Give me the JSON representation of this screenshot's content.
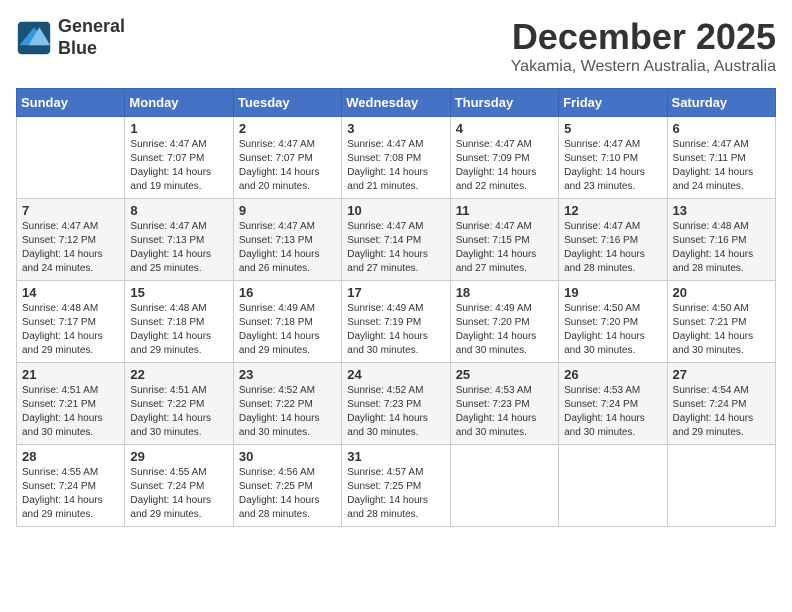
{
  "header": {
    "logo_line1": "General",
    "logo_line2": "Blue",
    "month": "December 2025",
    "location": "Yakamia, Western Australia, Australia"
  },
  "weekdays": [
    "Sunday",
    "Monday",
    "Tuesday",
    "Wednesday",
    "Thursday",
    "Friday",
    "Saturday"
  ],
  "weeks": [
    [
      {
        "day": "",
        "info": ""
      },
      {
        "day": "1",
        "info": "Sunrise: 4:47 AM\nSunset: 7:07 PM\nDaylight: 14 hours\nand 19 minutes."
      },
      {
        "day": "2",
        "info": "Sunrise: 4:47 AM\nSunset: 7:07 PM\nDaylight: 14 hours\nand 20 minutes."
      },
      {
        "day": "3",
        "info": "Sunrise: 4:47 AM\nSunset: 7:08 PM\nDaylight: 14 hours\nand 21 minutes."
      },
      {
        "day": "4",
        "info": "Sunrise: 4:47 AM\nSunset: 7:09 PM\nDaylight: 14 hours\nand 22 minutes."
      },
      {
        "day": "5",
        "info": "Sunrise: 4:47 AM\nSunset: 7:10 PM\nDaylight: 14 hours\nand 23 minutes."
      },
      {
        "day": "6",
        "info": "Sunrise: 4:47 AM\nSunset: 7:11 PM\nDaylight: 14 hours\nand 24 minutes."
      }
    ],
    [
      {
        "day": "7",
        "info": "Sunrise: 4:47 AM\nSunset: 7:12 PM\nDaylight: 14 hours\nand 24 minutes."
      },
      {
        "day": "8",
        "info": "Sunrise: 4:47 AM\nSunset: 7:13 PM\nDaylight: 14 hours\nand 25 minutes."
      },
      {
        "day": "9",
        "info": "Sunrise: 4:47 AM\nSunset: 7:13 PM\nDaylight: 14 hours\nand 26 minutes."
      },
      {
        "day": "10",
        "info": "Sunrise: 4:47 AM\nSunset: 7:14 PM\nDaylight: 14 hours\nand 27 minutes."
      },
      {
        "day": "11",
        "info": "Sunrise: 4:47 AM\nSunset: 7:15 PM\nDaylight: 14 hours\nand 27 minutes."
      },
      {
        "day": "12",
        "info": "Sunrise: 4:47 AM\nSunset: 7:16 PM\nDaylight: 14 hours\nand 28 minutes."
      },
      {
        "day": "13",
        "info": "Sunrise: 4:48 AM\nSunset: 7:16 PM\nDaylight: 14 hours\nand 28 minutes."
      }
    ],
    [
      {
        "day": "14",
        "info": "Sunrise: 4:48 AM\nSunset: 7:17 PM\nDaylight: 14 hours\nand 29 minutes."
      },
      {
        "day": "15",
        "info": "Sunrise: 4:48 AM\nSunset: 7:18 PM\nDaylight: 14 hours\nand 29 minutes."
      },
      {
        "day": "16",
        "info": "Sunrise: 4:49 AM\nSunset: 7:18 PM\nDaylight: 14 hours\nand 29 minutes."
      },
      {
        "day": "17",
        "info": "Sunrise: 4:49 AM\nSunset: 7:19 PM\nDaylight: 14 hours\nand 30 minutes."
      },
      {
        "day": "18",
        "info": "Sunrise: 4:49 AM\nSunset: 7:20 PM\nDaylight: 14 hours\nand 30 minutes."
      },
      {
        "day": "19",
        "info": "Sunrise: 4:50 AM\nSunset: 7:20 PM\nDaylight: 14 hours\nand 30 minutes."
      },
      {
        "day": "20",
        "info": "Sunrise: 4:50 AM\nSunset: 7:21 PM\nDaylight: 14 hours\nand 30 minutes."
      }
    ],
    [
      {
        "day": "21",
        "info": "Sunrise: 4:51 AM\nSunset: 7:21 PM\nDaylight: 14 hours\nand 30 minutes."
      },
      {
        "day": "22",
        "info": "Sunrise: 4:51 AM\nSunset: 7:22 PM\nDaylight: 14 hours\nand 30 minutes."
      },
      {
        "day": "23",
        "info": "Sunrise: 4:52 AM\nSunset: 7:22 PM\nDaylight: 14 hours\nand 30 minutes."
      },
      {
        "day": "24",
        "info": "Sunrise: 4:52 AM\nSunset: 7:23 PM\nDaylight: 14 hours\nand 30 minutes."
      },
      {
        "day": "25",
        "info": "Sunrise: 4:53 AM\nSunset: 7:23 PM\nDaylight: 14 hours\nand 30 minutes."
      },
      {
        "day": "26",
        "info": "Sunrise: 4:53 AM\nSunset: 7:24 PM\nDaylight: 14 hours\nand 30 minutes."
      },
      {
        "day": "27",
        "info": "Sunrise: 4:54 AM\nSunset: 7:24 PM\nDaylight: 14 hours\nand 29 minutes."
      }
    ],
    [
      {
        "day": "28",
        "info": "Sunrise: 4:55 AM\nSunset: 7:24 PM\nDaylight: 14 hours\nand 29 minutes."
      },
      {
        "day": "29",
        "info": "Sunrise: 4:55 AM\nSunset: 7:24 PM\nDaylight: 14 hours\nand 29 minutes."
      },
      {
        "day": "30",
        "info": "Sunrise: 4:56 AM\nSunset: 7:25 PM\nDaylight: 14 hours\nand 28 minutes."
      },
      {
        "day": "31",
        "info": "Sunrise: 4:57 AM\nSunset: 7:25 PM\nDaylight: 14 hours\nand 28 minutes."
      },
      {
        "day": "",
        "info": ""
      },
      {
        "day": "",
        "info": ""
      },
      {
        "day": "",
        "info": ""
      }
    ]
  ]
}
